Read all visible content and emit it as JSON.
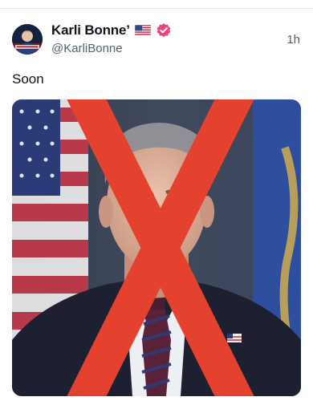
{
  "post": {
    "author": {
      "display_name": "Karli Bonne’",
      "handle": "@KarliBonne",
      "flag_icon": "us-flag-icon",
      "verified_icon": "verified-badge-icon",
      "verified_color": "#e8467c"
    },
    "timestamp": "1h",
    "text": "Soon",
    "media": {
      "icon": "photo-man-crossed-out",
      "overlay_color": "#e5412f"
    }
  }
}
